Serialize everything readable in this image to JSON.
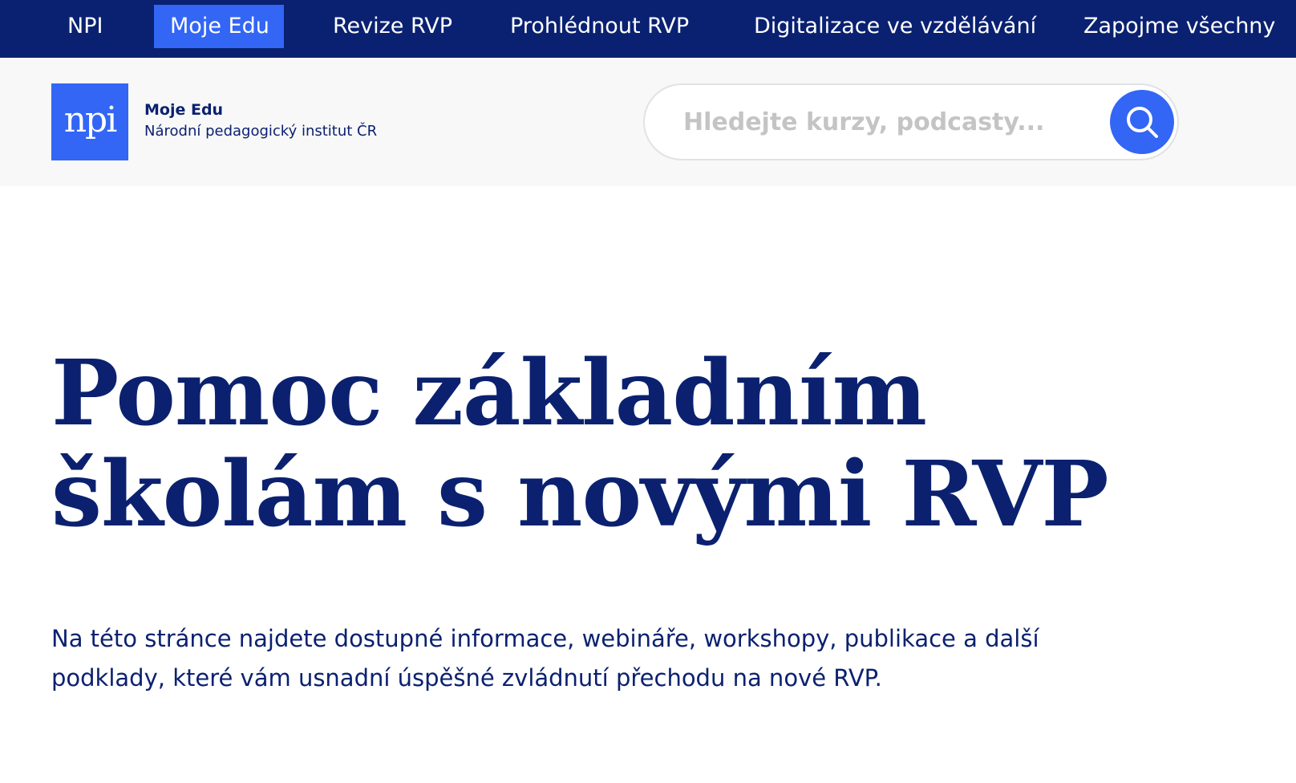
{
  "topnav": {
    "items": [
      {
        "label": "NPI",
        "active": false
      },
      {
        "label": "Moje Edu",
        "active": true
      },
      {
        "label": "Revize RVP",
        "active": false
      },
      {
        "label": "Prohlédnout RVP",
        "active": false
      },
      {
        "label": "Digitalizace ve vzdělávání",
        "active": false
      },
      {
        "label": "Zapojme všechny",
        "active": false
      }
    ]
  },
  "header": {
    "logo_text": "npi",
    "brand_title": "Moje Edu",
    "brand_subtitle": "Národní pedagogický institut ČR",
    "search": {
      "placeholder": "Hledejte kurzy, podcasty...",
      "value": "",
      "button_icon": "search-icon"
    }
  },
  "hero": {
    "title": "Pomoc základním školám s novými RVP",
    "description": "Na této stránce najdete dostupné informace, webináře, workshopy, publikace a další podklady, které vám usnadní úspěšné zvládnutí přechodu na nové RVP."
  },
  "colors": {
    "nav_bg": "#0a2171",
    "accent": "#3366f5",
    "text": "#0b2170",
    "header_bg": "#f8f8f8"
  }
}
